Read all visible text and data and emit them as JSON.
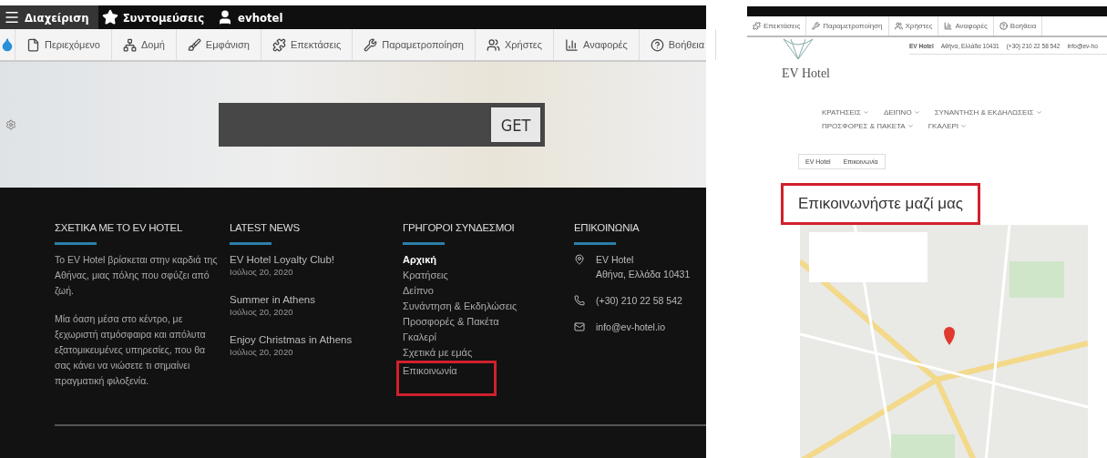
{
  "left_screenshot": {
    "admin_bar": {
      "items": [
        {
          "kind": "menu",
          "label": "Διαχείριση",
          "selected": true
        },
        {
          "kind": "star",
          "label": "Συντομεύσεις",
          "selected": false
        },
        {
          "kind": "user",
          "label": "evhotel",
          "selected": false
        }
      ]
    },
    "toolbar": {
      "items": [
        {
          "kind": "file",
          "label": "Περιεχόμενο"
        },
        {
          "kind": "structure",
          "label": "Δομή"
        },
        {
          "kind": "brush",
          "label": "Εμφάνιση"
        },
        {
          "kind": "puzzle",
          "label": "Επεκτάσεις"
        },
        {
          "kind": "wrench",
          "label": "Παραμετροποίηση"
        },
        {
          "kind": "users",
          "label": "Χρήστες"
        },
        {
          "kind": "chart",
          "label": "Αναφορές"
        },
        {
          "kind": "help",
          "label": "Βοήθεια"
        }
      ]
    },
    "hero": {
      "search_button": "GET"
    },
    "footer": {
      "about": {
        "title": "ΣΧΕΤΙΚΑ ΜΕ ΤΟ EV HOTEL",
        "paragraphs": [
          "Το EV Hotel βρίσκεται στην καρδιά της Αθήνας, μιας πόλης που σφύζει από ζωή.",
          "Μία όαση μέσα στο κέντρο, με ξεχωριστή ατμόσφαιρα και απόλυτα εξατομικευμένες υπηρεσίες, που θα σας κάνει να νιώσετε τι σημαίνει πραγματική φιλοξενία."
        ]
      },
      "news": {
        "title": "LATEST NEWS",
        "items": [
          {
            "title": "EV Hotel Loyalty Club!",
            "date": "Ιούλιος 20, 2020"
          },
          {
            "title": "Summer in Athens",
            "date": "Ιούλιος 20, 2020"
          },
          {
            "title": "Enjoy Christmas in Athens",
            "date": "Ιούλιος 20, 2020"
          }
        ]
      },
      "quick_links": {
        "title": "ΓΡΗΓΟΡΟΙ ΣΥΝΔΕΣΜΟΙ",
        "links": [
          {
            "label": "Αρχική",
            "selected": true,
            "highlighted": false
          },
          {
            "label": "Κρατήσεις",
            "selected": false,
            "highlighted": false
          },
          {
            "label": "Δείπνο",
            "selected": false,
            "highlighted": false
          },
          {
            "label": "Συνάντηση & Εκδηλώσεις",
            "selected": false,
            "highlighted": false
          },
          {
            "label": "Προσφορές & Πακέτα",
            "selected": false,
            "highlighted": false
          },
          {
            "label": "Γκαλερί",
            "selected": false,
            "highlighted": false
          },
          {
            "label": "Σχετικά με εμάς",
            "selected": false,
            "highlighted": false
          },
          {
            "label": "Επικοινωνία",
            "selected": false,
            "highlighted": true
          }
        ]
      },
      "contact": {
        "title": "ΕΠΙΚΟΙΝΩΝΙΑ",
        "items": [
          {
            "kind": "location",
            "lines": [
              "EV Hotel",
              "Αθήνα, Ελλάδα 10431"
            ]
          },
          {
            "kind": "phone",
            "lines": [
              "(+30) 210 22 58 542"
            ]
          },
          {
            "kind": "email",
            "lines": [
              "info@ev-hotel.io"
            ]
          }
        ]
      }
    }
  },
  "right_screenshot": {
    "toolbar": {
      "items": [
        {
          "kind": "puzzle",
          "label": "Επεκτάσεις"
        },
        {
          "kind": "wrench",
          "label": "Παραμετροποίηση"
        },
        {
          "kind": "users",
          "label": "Χρήστες"
        },
        {
          "kind": "chart",
          "label": "Αναφορές"
        },
        {
          "kind": "help",
          "label": "Βοήθεια"
        }
      ]
    },
    "logo_text": "EV Hotel",
    "contact_bar": {
      "name": "EV Hotel",
      "address": "Αθήνα, Ελλάδα 10431",
      "phone": "(+30) 210 22 58 542",
      "email": "info@ev-ho"
    },
    "menu": [
      "ΚΡΑΤΗΣΕΙΣ",
      "ΔΕΙΠΝΟ",
      "ΣΥΝΑΝΤΗΣΗ & ΕΚΔΗΛΩΣΕΙΣ",
      "ΠΡΟΣΦΟΡΕΣ & ΠΑΚΕΤΑ",
      "ΓΚΑΛΕΡΙ"
    ],
    "breadcrumb": [
      "EV Hotel",
      "Επικοινωνία"
    ],
    "heading": {
      "text": "Επικοινωνήστε μαζί μας",
      "highlighted": true
    }
  }
}
